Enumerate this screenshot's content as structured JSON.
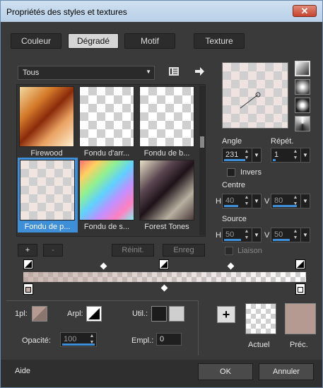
{
  "window": {
    "title": "Propriétés des styles et textures",
    "close": "✕"
  },
  "tabs": [
    {
      "label": "Couleur",
      "active": false
    },
    {
      "label": "Dégradé",
      "active": true
    },
    {
      "label": "Motif",
      "active": false
    },
    {
      "label": "Texture",
      "active": false
    }
  ],
  "category": {
    "selected": "Tous"
  },
  "gradients": [
    {
      "name": "Firewood",
      "selected": false
    },
    {
      "name": "Fondu d'arr...",
      "selected": false
    },
    {
      "name": "Fondu de b...",
      "selected": false
    },
    {
      "name": "Fondu de p...",
      "selected": true
    },
    {
      "name": "Fondu de s...",
      "selected": false
    },
    {
      "name": "Forest Tones",
      "selected": false
    }
  ],
  "list_buttons": {
    "add": "+",
    "remove": "-",
    "reset": "Réinit.",
    "save": "Enreg"
  },
  "angle": {
    "label": "Angle",
    "value": "231"
  },
  "repeat": {
    "label": "Répét.",
    "value": "1"
  },
  "invert": {
    "label": "Invers",
    "checked": false
  },
  "center": {
    "label": "Centre",
    "h_label": "H",
    "h": "40",
    "v_label": "V",
    "v": "80"
  },
  "source": {
    "label": "Source",
    "h_label": "H",
    "h": "50",
    "v_label": "V",
    "v": "50",
    "link_label": "Liaison"
  },
  "bottom": {
    "point_label": "1pl:",
    "arpl_label": "Arpl:",
    "util_label": "Util.:",
    "opacity_label": "Opacité:",
    "opacity_value": "100",
    "empl_label": "Empl.:",
    "empl_value": "0",
    "current_label": "Actuel",
    "previous_label": "Préc.",
    "add": "+"
  },
  "footer": {
    "help": "Aide",
    "ok": "OK",
    "cancel": "Annuler"
  },
  "colors": {
    "accent": "#3f8fd8",
    "previous": "#b59a92",
    "stop": "#c4aaa3"
  }
}
